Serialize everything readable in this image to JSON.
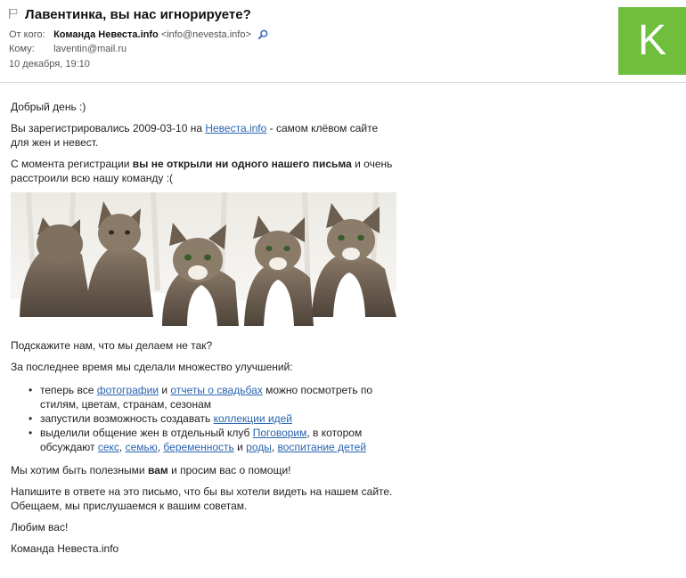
{
  "message": {
    "subject": "Лавентинка, вы нас игнорируете?",
    "from_label": "От кого:",
    "sender_name": "Команда Невеста.info",
    "sender_email": "<info@nevesta.info>",
    "to_label": "Кому:",
    "recipient": "laventin@mail.ru",
    "date": "10 декабря, 19:10",
    "avatar_letter": "K",
    "avatar_color": "#6fbf3c"
  },
  "body": {
    "greeting": "Добрый день :)",
    "registered": {
      "before": "Вы зарегистрировались 2009-03-10 на ",
      "link": "Невеста.info",
      "after": " - самом клёвом сайте для жен и невест."
    },
    "opened": {
      "before": "С момента регистрации ",
      "bold": "вы не открыли ни одного нашего письма",
      "after": " и очень расстроили всю нашу команду :("
    },
    "ask": "Подскажите нам, что мы делаем не так?",
    "improvements_intro": "За последнее время мы сделали множество улучшений:",
    "features": {
      "f1": {
        "before": "теперь все ",
        "link1": "фотографии",
        "mid": " и ",
        "link2": "отчеты о свадьбах",
        "after": " можно посмотреть по стилям, цветам, странам, сезонам"
      },
      "f2": {
        "before": "запустили возможность создавать ",
        "link": "коллекции идей"
      },
      "f3": {
        "before": "выделили общение жен в отдельный клуб ",
        "link_club": "Поговорим",
        "mid": ", в котором обсуждают ",
        "link_a": "секс",
        "sep1": ", ",
        "link_b": "семью",
        "sep2": ", ",
        "link_c": "беременность",
        "and": " и ",
        "link_d": "роды",
        "sep3": ", ",
        "link_e": "воспитание детей"
      }
    },
    "helpful": {
      "before": "Мы хотим быть полезными ",
      "bold": "вам",
      "after": " и просим вас о помощи!"
    },
    "write": "Напишите в ответе на это письмо, что бы вы хотели видеть на нашем сайте. Обещаем, мы прислушаемся к вашим советам.",
    "love": "Любим вас!",
    "signature": "Команда Невеста.info"
  },
  "icons": {
    "flag": "flag-icon",
    "search": "magnifier-icon"
  }
}
